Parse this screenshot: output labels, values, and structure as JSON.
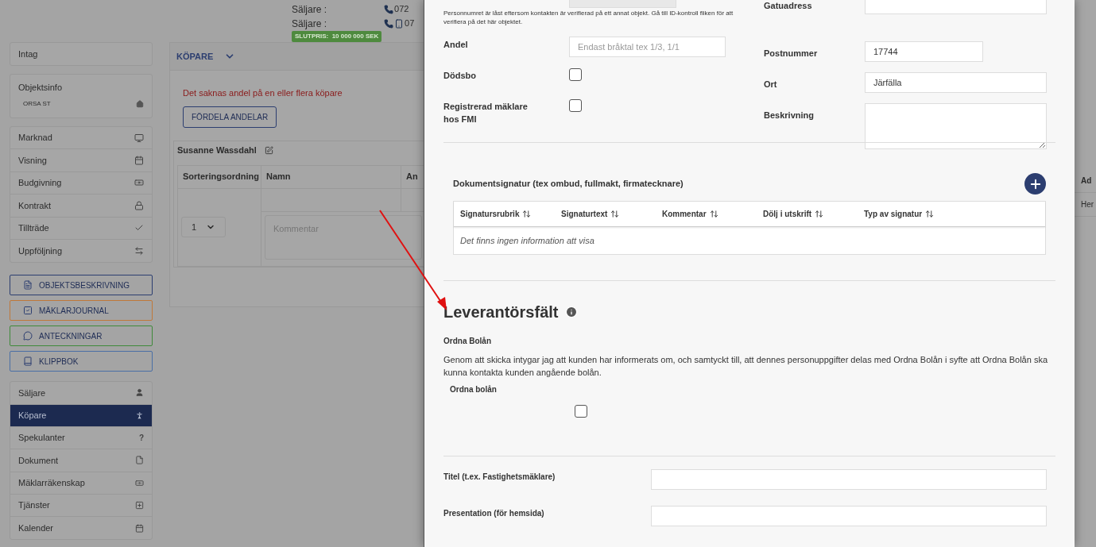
{
  "header": {
    "sellers": [
      {
        "label": "Säljare :",
        "phone": "072",
        "kind": "phone"
      },
      {
        "label": "Säljare :",
        "phone": "07",
        "kind": "phone_mobile"
      }
    ],
    "final_price": "SLUTPRIS:  10 000 000 SEK"
  },
  "sidebar": {
    "top": [
      {
        "label": "Intag"
      }
    ],
    "object_info": {
      "title": "Objektsinfo",
      "address": "ORSA ST"
    },
    "steps": [
      {
        "label": "Marknad"
      },
      {
        "label": "Visning"
      },
      {
        "label": "Budgivning"
      },
      {
        "label": "Kontrakt"
      },
      {
        "label": "Tillträde"
      },
      {
        "label": "Uppföljning"
      }
    ],
    "buttons": [
      {
        "label": "OBJEKTSBESKRIVNING",
        "color": "#2c3e70"
      },
      {
        "label": "MÄKLARJOURNAL",
        "color": "#c0783a"
      },
      {
        "label": "ANTECKNINGAR",
        "color": "#3f8a3a"
      },
      {
        "label": "KLIPPBOK",
        "color": "#4a6fa5"
      }
    ],
    "sections": [
      {
        "label": "Säljare",
        "selected": false
      },
      {
        "label": "Köpare",
        "selected": true
      },
      {
        "label": "Spekulanter",
        "selected": false,
        "glyph": "?"
      },
      {
        "label": "Dokument",
        "selected": false
      },
      {
        "label": "Mäklarräkenskap",
        "selected": false
      },
      {
        "label": "Tjänster",
        "selected": false
      },
      {
        "label": "Kalender",
        "selected": false
      }
    ]
  },
  "buyers_panel": {
    "title": "KÖPARE",
    "warning": "Det saknas andel på en eller flera köpare",
    "button": "FÖRDELA ANDELAR",
    "buyer": {
      "name": "Susanne Wassdahl",
      "columns": [
        "Sorteringsordning",
        "Namn",
        "An"
      ],
      "order": "1",
      "comment_placeholder": "Kommentar"
    }
  },
  "modal": {
    "lock_notice": "Personnumret är låst eftersom kontakten är verifierad på ett annat objekt. Gå till ID-kontroll fliken för att verifiera på det här objektet.",
    "left_fields": [
      {
        "kind": "text",
        "label": "Andel",
        "placeholder": "Endast bråktal tex 1/3, 1/1"
      },
      {
        "kind": "checkbox",
        "label": "Dödsbo",
        "checked": false
      },
      {
        "kind": "checkbox",
        "label": "Registrerad mäklare hos FMI",
        "checked": false
      }
    ],
    "right_fields": [
      {
        "kind": "text",
        "label": "Gatuadress"
      },
      {
        "kind": "short",
        "label": "Postnummer",
        "value": "17744"
      },
      {
        "kind": "text",
        "label": "Ort",
        "value": "Järfälla"
      },
      {
        "kind": "textarea",
        "label": "Beskrivning"
      }
    ],
    "signatures": {
      "title": "Dokumentsignatur (tex ombud, fullmakt, firmatecknare)",
      "columns": [
        "Signatursrubrik",
        "Signaturtext",
        "Kommentar",
        "Dölj i utskrift",
        "Typ av signatur"
      ],
      "empty": "Det finns ingen information att visa"
    },
    "supplier": {
      "title": "Leverantörsfält",
      "section": "Ordna Bolån",
      "consent": "Genom att skicka intygar jag att kunden har informerats om, och samtyckt till, att dennes personuppgifter delas med Ordna Bolån i syfte att Ordna Bolån ska kunna kontakta kunden angående bolån.",
      "checkbox_label": "Ordna bolån",
      "checked": false
    },
    "profile_fields": [
      {
        "label": "Titel (t.ex. Fastighetsmäklare)"
      },
      {
        "label": "Presentation (för hemsida)"
      }
    ]
  },
  "background_right": [
    "Ad",
    "Her"
  ]
}
